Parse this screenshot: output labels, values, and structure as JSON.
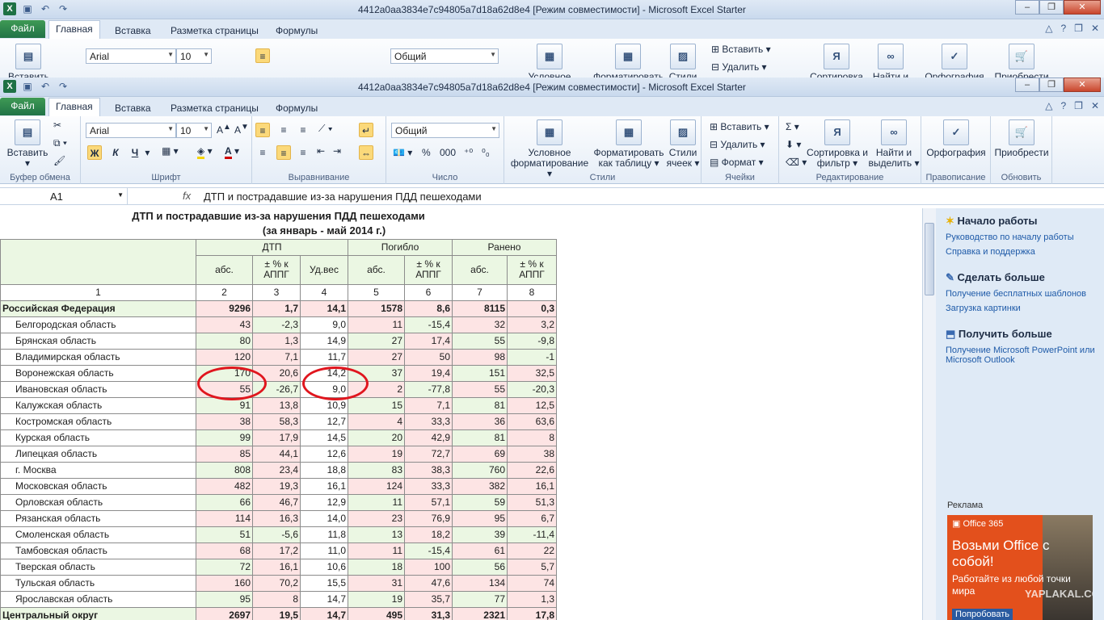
{
  "window": {
    "title": "4412a0aa3834e7c94805a7d18a62d8e4  [Режим совместимости]  -  Microsoft Excel Starter",
    "controls": [
      "–",
      "❐",
      "✕"
    ]
  },
  "tabs": {
    "file": "Файл",
    "home": "Главная",
    "insert": "Вставка",
    "layout": "Разметка страницы",
    "formulas": "Формулы"
  },
  "ribbon": {
    "clipboard": {
      "paste": "Вставить",
      "label": "Буфер обмена"
    },
    "font": {
      "name": "Arial",
      "size": "10",
      "bold": "Ж",
      "italic": "К",
      "underline": "Ч",
      "label": "Шрифт"
    },
    "align": {
      "label": "Выравнивание"
    },
    "number": {
      "format": "Общий",
      "percent": "%",
      "thousands": "000",
      "label": "Число"
    },
    "styles": {
      "cond": "Условное форматирование ▾",
      "astable": "Форматировать как таблицу ▾",
      "cellstyles": "Стили ячеек ▾",
      "label": "Стили"
    },
    "cells": {
      "insert": "Вставить",
      "delete": "Удалить",
      "format": "Формат",
      "label": "Ячейки"
    },
    "edit": {
      "sort": "Сортировка и фильтр ▾",
      "find": "Найти и выделить ▾",
      "label": "Редактирование"
    },
    "spelling": {
      "btn": "Орфография",
      "label": "Правописание"
    },
    "update": {
      "btn": "Приобрести",
      "label": "Обновить"
    },
    "back_partial": {
      "paste": "Вставить",
      "cond": "Условное",
      "astable": "Форматировать",
      "cellstyles": "Стили",
      "sort": "Сортировка",
      "find": "Найти и",
      "spelling": "Орфография",
      "update": "Приобрести"
    }
  },
  "formula_bar": {
    "cell": "A1",
    "fx": "fx",
    "value": "ДТП и пострадавшие из-за нарушения ПДД пешеходами"
  },
  "sheet": {
    "title1": "ДТП и пострадавшие из-за нарушения ПДД пешеходами",
    "title2": "(за январь - май 2014 г.)",
    "groups": [
      "ДТП",
      "Погибло",
      "Ранено"
    ],
    "subheads": [
      "абс.",
      "± % к АППГ",
      "Уд.вес",
      "абс.",
      "± % к АППГ",
      "абс.",
      "± % к АППГ"
    ],
    "colnums": [
      "1",
      "2",
      "3",
      "4",
      "5",
      "6",
      "7",
      "8"
    ],
    "rows": [
      {
        "name": "Российская Федерация",
        "v": [
          "9296",
          "1,7",
          "14,1",
          "1578",
          "8,6",
          "8115",
          "0,3"
        ],
        "bold": true
      },
      {
        "name": "Белгородская область",
        "v": [
          "43",
          "-2,3",
          "9,0",
          "11",
          "-15,4",
          "32",
          "3,2"
        ]
      },
      {
        "name": "Брянская область",
        "v": [
          "80",
          "1,3",
          "14,9",
          "27",
          "17,4",
          "55",
          "-9,8"
        ]
      },
      {
        "name": "Владимирская область",
        "v": [
          "120",
          "7,1",
          "11,7",
          "27",
          "50",
          "98",
          "-1"
        ]
      },
      {
        "name": "Воронежская область",
        "v": [
          "170",
          "20,6",
          "14,2",
          "37",
          "19,4",
          "151",
          "32,5"
        ]
      },
      {
        "name": "Ивановская область",
        "v": [
          "55",
          "-26,7",
          "9,0",
          "2",
          "-77,8",
          "55",
          "-20,3"
        ]
      },
      {
        "name": "Калужская область",
        "v": [
          "91",
          "13,8",
          "10,9",
          "15",
          "7,1",
          "81",
          "12,5"
        ]
      },
      {
        "name": "Костромская область",
        "v": [
          "38",
          "58,3",
          "12,7",
          "4",
          "33,3",
          "36",
          "63,6"
        ]
      },
      {
        "name": "Курская область",
        "v": [
          "99",
          "17,9",
          "14,5",
          "20",
          "42,9",
          "81",
          "8"
        ]
      },
      {
        "name": "Липецкая область",
        "v": [
          "85",
          "44,1",
          "12,6",
          "19",
          "72,7",
          "69",
          "38"
        ]
      },
      {
        "name": "г. Москва",
        "v": [
          "808",
          "23,4",
          "18,8",
          "83",
          "38,3",
          "760",
          "22,6"
        ]
      },
      {
        "name": "Московская область",
        "v": [
          "482",
          "19,3",
          "16,1",
          "124",
          "33,3",
          "382",
          "16,1"
        ]
      },
      {
        "name": "Орловская область",
        "v": [
          "66",
          "46,7",
          "12,9",
          "11",
          "57,1",
          "59",
          "51,3"
        ]
      },
      {
        "name": "Рязанская область",
        "v": [
          "114",
          "16,3",
          "14,0",
          "23",
          "76,9",
          "95",
          "6,7"
        ]
      },
      {
        "name": "Смоленская область",
        "v": [
          "51",
          "-5,6",
          "11,8",
          "13",
          "18,2",
          "39",
          "-11,4"
        ]
      },
      {
        "name": "Тамбовская область",
        "v": [
          "68",
          "17,2",
          "11,0",
          "11",
          "-15,4",
          "61",
          "22"
        ]
      },
      {
        "name": "Тверская область",
        "v": [
          "72",
          "16,1",
          "10,6",
          "18",
          "100",
          "56",
          "5,7"
        ]
      },
      {
        "name": "Тульская область",
        "v": [
          "160",
          "70,2",
          "15,5",
          "31",
          "47,6",
          "134",
          "74"
        ]
      },
      {
        "name": "Ярославская область",
        "v": [
          "95",
          "8",
          "14,7",
          "19",
          "35,7",
          "77",
          "1,3"
        ]
      },
      {
        "name": "Центральный округ",
        "v": [
          "2697",
          "19,5",
          "14,7",
          "495",
          "31,3",
          "2321",
          "17,8"
        ],
        "bold": true
      }
    ]
  },
  "pane": {
    "s1": "Начало работы",
    "l1a": "Руководство по началу работы",
    "l1b": "Справка и поддержка",
    "s2": "Сделать больше",
    "l2a": "Получение бесплатных шаблонов",
    "l2b": "Загрузка картинки",
    "s3": "Получить больше",
    "l3a": "Получение Microsoft PowerPoint или Microsoft Outlook",
    "ad_label": "Реклама",
    "ad_brand": "Office 365",
    "ad_big": "Возьми Office с собой!",
    "ad_sub": "Работайте из любой точки мира",
    "ad_btn": "Попробовать",
    "watermark": "YAPLAKAL.COM"
  }
}
